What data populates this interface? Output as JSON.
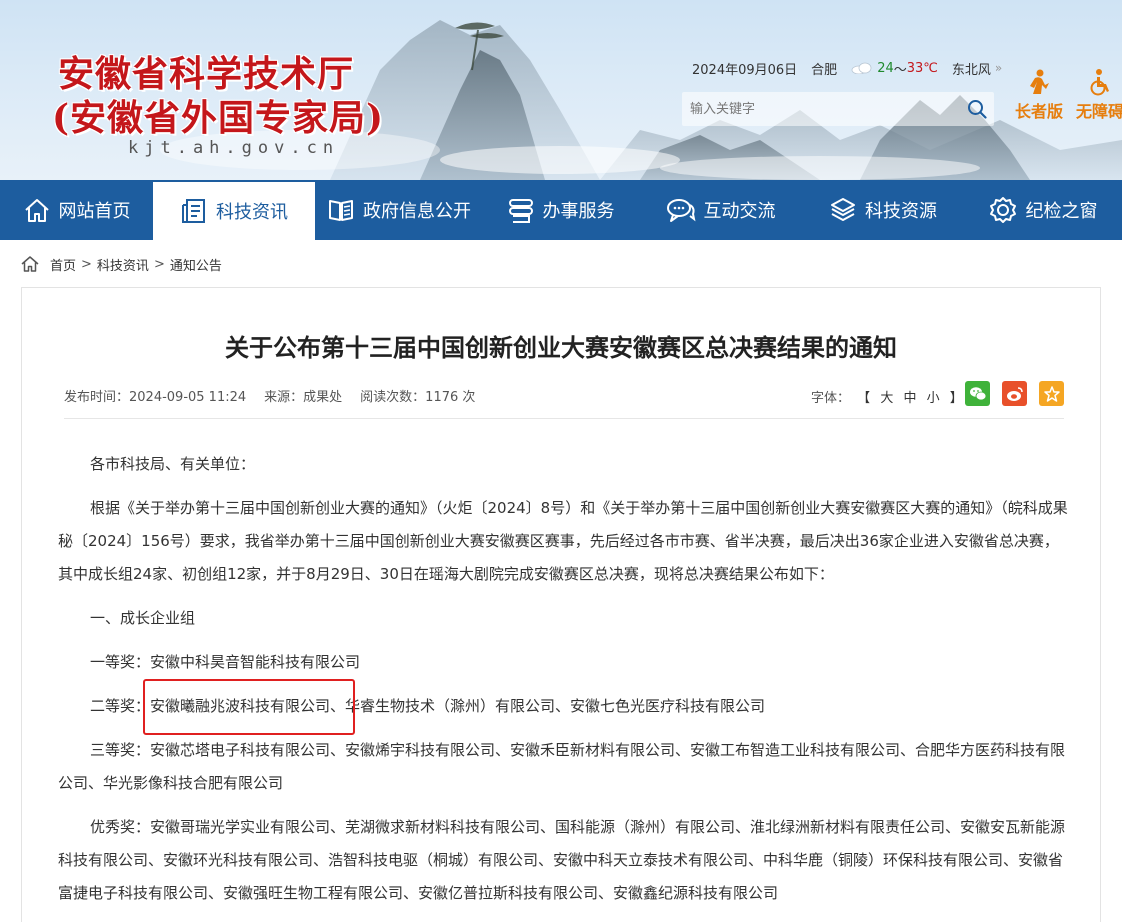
{
  "header": {
    "title_line1": "安徽省科学技术厅",
    "title_line2": "(安徽省外国专家局)",
    "domain": "kjt.ah.gov.cn",
    "date": "2024年09月06日",
    "city": "合肥",
    "temp_low": "24",
    "temp_sep": "～",
    "temp_high": "33℃",
    "wind": "东北风",
    "wind_more": "»",
    "search_placeholder": "输入关键字",
    "elder_label": "长者版",
    "accessible_label": "无障碍"
  },
  "nav": {
    "items": [
      {
        "label": "网站首页",
        "icon": "home-icon"
      },
      {
        "label": "科技资讯",
        "icon": "document-icon"
      },
      {
        "label": "政府信息公开",
        "icon": "book-icon"
      },
      {
        "label": "办事服务",
        "icon": "service-icon"
      },
      {
        "label": "互动交流",
        "icon": "chat-icon"
      },
      {
        "label": "科技资源",
        "icon": "cube-icon"
      },
      {
        "label": "纪检之窗",
        "icon": "gear-icon"
      }
    ],
    "active_index": 1
  },
  "breadcrumb": {
    "items": [
      "首页",
      "科技资讯",
      "通知公告"
    ],
    "sep": ">"
  },
  "article": {
    "title": "关于公布第十三届中国创新创业大赛安徽赛区总决赛结果的通知",
    "publish_time": "发布时间：2024-09-05 11:24",
    "source": "来源：成果处",
    "views": "阅读次数：1176 次",
    "font_label": "字体：",
    "font_open": "【",
    "font_large": "大",
    "font_medium": "中",
    "font_small": "小",
    "font_close": "】",
    "paragraphs": {
      "p1": "各市科技局、有关单位：",
      "p2": "根据《关于举办第十三届中国创新创业大赛的通知》（火炬〔2024〕8号）和《关于举办第十三届中国创新创业大赛安徽赛区大赛的通知》（皖科成果秘〔2024〕156号）要求，我省举办第十三届中国创新创业大赛安徽赛区赛事，先后经过各市市赛、省半决赛，最后决出36家企业进入安徽省总决赛，其中成长组24家、初创组12家，并于8月29日、30日在瑶海大剧院完成安徽赛区总决赛，现将总决赛结果公布如下：",
      "p3": "一、成长企业组",
      "p4": "一等奖：安徽中科昊音智能科技有限公司",
      "p5": "二等奖：安徽曦融兆波科技有限公司、华睿生物技术（滁州）有限公司、安徽七色光医疗科技有限公司",
      "p6": "三等奖：安徽芯塔电子科技有限公司、安徽烯宇科技有限公司、安徽禾臣新材料有限公司、安徽工布智造工业科技有限公司、合肥华方医药科技有限公司、华光影像科技合肥有限公司",
      "p7": "优秀奖：安徽哥瑞光学实业有限公司、芜湖微求新材料科技有限公司、国科能源（滁州）有限公司、淮北绿洲新材料有限责任公司、安徽安瓦新能源科技有限公司、安徽环光科技有限公司、浩智科技电驱（桐城）有限公司、安徽中科天立泰技术有限公司、中科华鹿（铜陵）环保科技有限公司、安徽省富捷电子科技有限公司、安徽强旺生物工程有限公司、安徽亿普拉斯科技有限公司、安徽鑫纪源科技有限公司"
    }
  },
  "colors": {
    "brand_blue": "#1d5d9f",
    "title_red": "#c4171b",
    "accent_orange": "#e67e0e",
    "highlight_box": "#e02020"
  }
}
